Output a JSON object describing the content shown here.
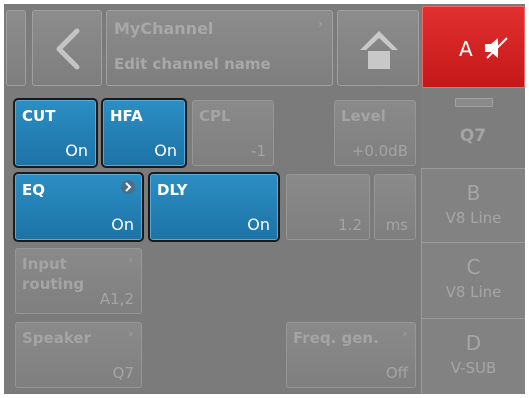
{
  "header": {
    "channel_title": "MyChannel",
    "channel_subtitle": "Edit channel name",
    "channel_chevron": "›",
    "active_channel_letter": "A",
    "active_channel_color": "#d82121",
    "back_icon": "chevron-left-icon",
    "home_icon": "home-icon",
    "mute_icon": "speaker-mute-icon"
  },
  "controls": {
    "cut": {
      "label": "CUT",
      "value": "On"
    },
    "hfa": {
      "label": "HFA",
      "value": "On"
    },
    "cpl": {
      "label": "CPL",
      "value": "-1"
    },
    "level": {
      "label": "Level",
      "value": "+0.0dB"
    },
    "eq": {
      "label": "EQ",
      "value": "On"
    },
    "dly": {
      "label": "DLY",
      "value": "On"
    },
    "delay_value": "1.2",
    "delay_unit": "ms",
    "input_routing": {
      "label_line1": "Input",
      "label_line2": "routing",
      "value": "A1,2"
    },
    "speaker": {
      "label": "Speaker",
      "value": "Q7"
    },
    "freq_gen": {
      "label": "Freq. gen.",
      "value": "Off"
    }
  },
  "channels": {
    "a": {
      "name": "Q7"
    },
    "b": {
      "letter": "B",
      "name": "V8 Line"
    },
    "c": {
      "letter": "C",
      "name": "V8 Line"
    },
    "d": {
      "letter": "D",
      "name": "V-SUB"
    }
  },
  "colors": {
    "active_blue": "#2582b8",
    "background": "#7b7b7b"
  }
}
